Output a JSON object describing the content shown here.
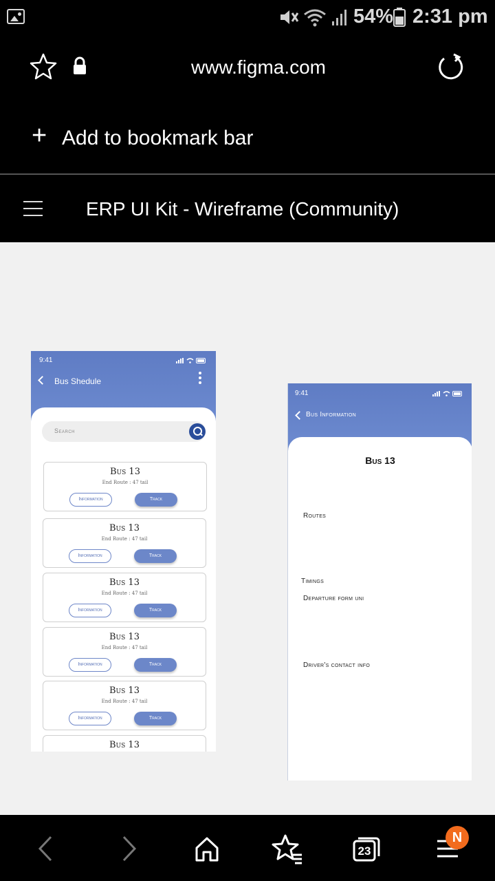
{
  "status_bar": {
    "battery": "54%",
    "time": "2:31 pm"
  },
  "browser": {
    "url": "www.figma.com",
    "bookmark_action": "Add to bookmark bar",
    "tab_count": "23",
    "menu_badge": "N"
  },
  "figma": {
    "file_title": "ERP UI Kit - Wireframe (Community)"
  },
  "frame_bus_schedule": {
    "time": "9:41",
    "title": "Bus Shedule",
    "search_placeholder": "Search",
    "cards": [
      {
        "bus": "Bus 13",
        "route": "End Route : 47 tail",
        "info_label": "Information",
        "track_label": "Track"
      },
      {
        "bus": "Bus 13",
        "route": "End Route : 47 tail",
        "info_label": "Information",
        "track_label": "Track"
      },
      {
        "bus": "Bus 13",
        "route": "End Route : 47 tail",
        "info_label": "Information",
        "track_label": "Track"
      },
      {
        "bus": "Bus 13",
        "route": "End Route : 47 tail",
        "info_label": "Information",
        "track_label": "Track"
      },
      {
        "bus": "Bus 13",
        "route": "End Route : 47 tail",
        "info_label": "Information",
        "track_label": "Track"
      },
      {
        "bus": "Bus 13"
      }
    ]
  },
  "frame_bus_information": {
    "time": "9:41",
    "title": "Bus Information",
    "heading": "Bus 13",
    "routes_label": "Routes",
    "timings_label": "Timings",
    "departure_label": "Departure form uni",
    "driver_label": "Driver's contact info"
  },
  "colors": {
    "accent_blue": "#6c87c9",
    "header_gradient": "#5f7cc4",
    "canvas_bg": "#f1f1f1",
    "badge_orange": "#f26b1d"
  }
}
